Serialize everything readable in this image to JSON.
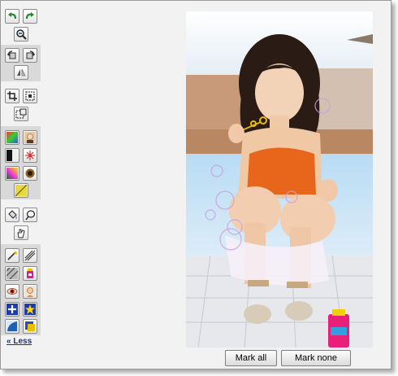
{
  "toolbar": {
    "groups": [
      {
        "tools": [
          "undo-icon",
          "redo-icon",
          "zoom-out-icon"
        ]
      },
      {
        "tools": [
          "rotate-left-icon",
          "rotate-right-icon",
          "flip-icon"
        ]
      },
      {
        "tools": [
          "crop-icon",
          "resize-icon",
          "canvas-icon"
        ]
      },
      {
        "tools": [
          "color-balance-icon",
          "portrait-icon",
          "contrast-icon",
          "sharpen-icon",
          "hue-icon",
          "blur-icon",
          "gradient-icon"
        ]
      },
      {
        "tools": [
          "fill-bucket-icon",
          "lasso-icon",
          "hand-icon"
        ]
      },
      {
        "tools": [
          "wand-icon",
          "brush-icon",
          "eraser-icon",
          "paint-can-icon",
          "red-eye-icon",
          "face-icon",
          "add-icon",
          "star-icon",
          "curve-icon",
          "layer-icon"
        ]
      }
    ],
    "less_link": "« Less"
  },
  "buttons": {
    "mark_all": "Mark all",
    "mark_none": "Mark none"
  },
  "colors": {
    "panel_bg": "#f2f2f2",
    "group_bg": "#d9d9d9",
    "link": "#1b2f8a"
  }
}
